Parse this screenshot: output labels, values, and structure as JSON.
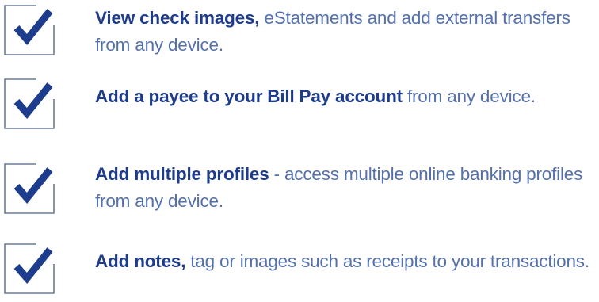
{
  "colors": {
    "checkbox_border": "#6b7c97",
    "checkmark": "#1e3c8c",
    "lead_text": "#1e3c8c",
    "body_text": "#5470ad"
  },
  "features": [
    {
      "icon": "checkbox-checked-icon",
      "lead": "View check images,",
      "rest": " eStatements and add external transfers from any device."
    },
    {
      "icon": "checkbox-checked-icon",
      "lead": "Add a payee to your Bill Pay account",
      "rest": " from any device."
    },
    {
      "icon": "checkbox-checked-icon",
      "lead": "Add multiple profiles",
      "rest": " - access multiple online banking profiles from any device."
    },
    {
      "icon": "checkbox-checked-icon",
      "lead": "Add notes,",
      "rest": " tag or images such as receipts to your transactions."
    }
  ]
}
